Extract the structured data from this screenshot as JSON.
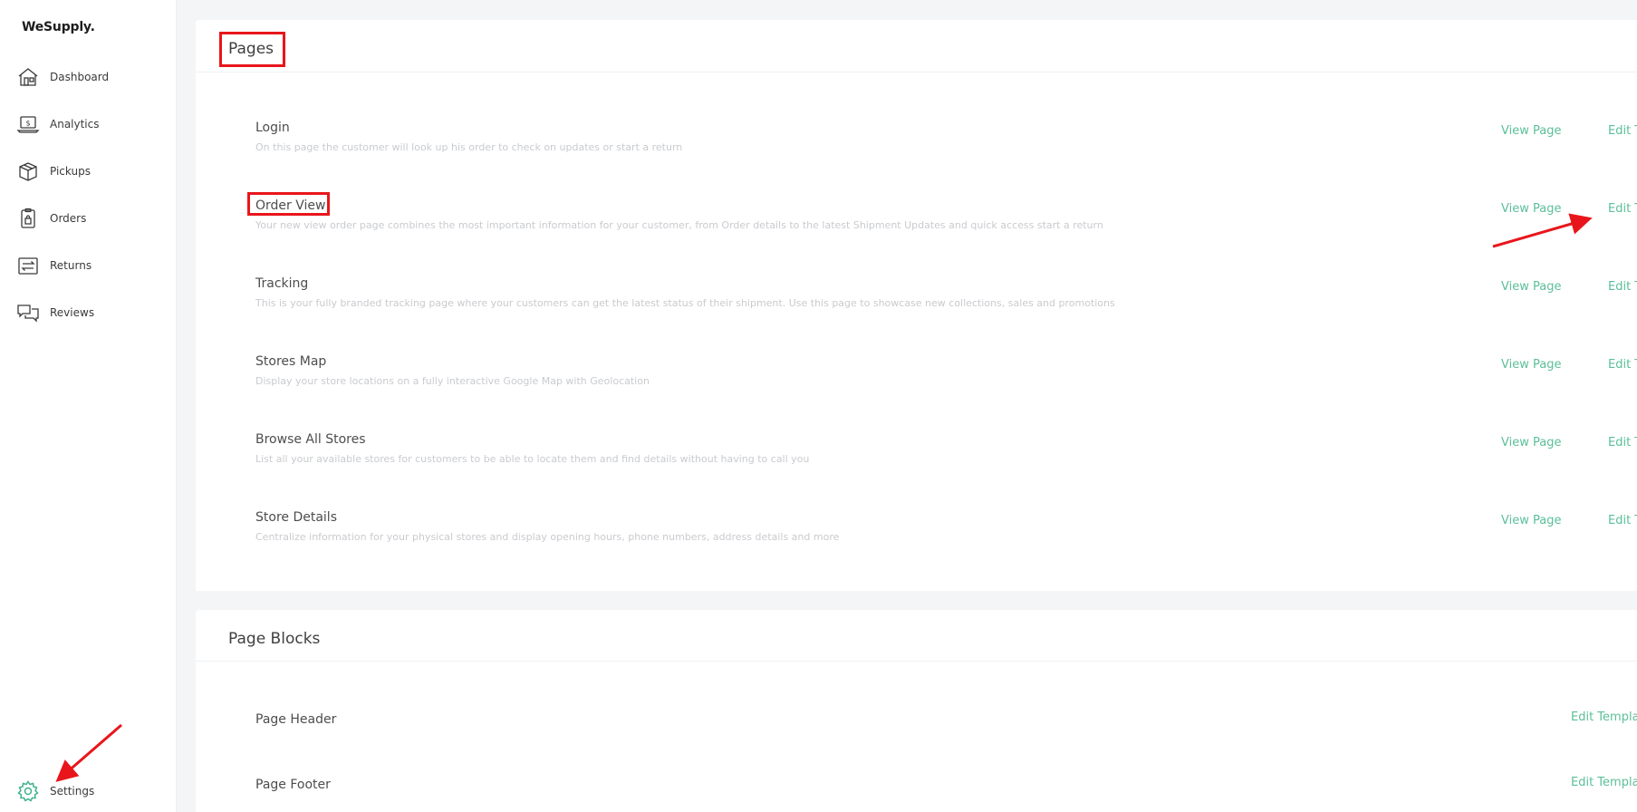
{
  "app": {
    "brand": "WeSupply."
  },
  "sidebar": {
    "items": [
      {
        "label": "Dashboard",
        "icon": "house-icon"
      },
      {
        "label": "Analytics",
        "icon": "laptop-dollar-icon"
      },
      {
        "label": "Pickups",
        "icon": "box-icon"
      },
      {
        "label": "Orders",
        "icon": "clipboard-icon"
      },
      {
        "label": "Returns",
        "icon": "returns-icon"
      },
      {
        "label": "Reviews",
        "icon": "chat-bubbles-icon"
      }
    ],
    "settings": {
      "label": "Settings",
      "icon": "gear-icon",
      "icon_color": "#3fb28a"
    }
  },
  "pages_section": {
    "title": "Pages",
    "view_label": "View Page",
    "edit_label": "Edit Template",
    "rows": [
      {
        "title": "Login",
        "desc": "On this page the customer will look up his order to check on updates or start a return"
      },
      {
        "title": "Order View",
        "desc": "Your new view order page combines the most important information for your customer, from Order details to the latest Shipment Updates and quick access start a return"
      },
      {
        "title": "Tracking",
        "desc": "This is your fully branded tracking page where your customers can get the latest status of their shipment. Use this page to showcase new collections, sales and promotions"
      },
      {
        "title": "Stores Map",
        "desc": "Display your store locations on a fully interactive Google Map with Geolocation"
      },
      {
        "title": "Browse All Stores",
        "desc": "List all your available stores for customers to be able to locate them and find details without having to call you"
      },
      {
        "title": "Store Details",
        "desc": "Centralize information for your physical stores and display opening hours, phone numbers, address details and more"
      }
    ]
  },
  "blocks_section": {
    "title": "Page Blocks",
    "edit_label": "Edit Template",
    "rows": [
      {
        "title": "Page Header"
      },
      {
        "title": "Page Footer"
      }
    ]
  },
  "colors": {
    "accent": "#5bbf99",
    "annotation": "#e8161b"
  }
}
